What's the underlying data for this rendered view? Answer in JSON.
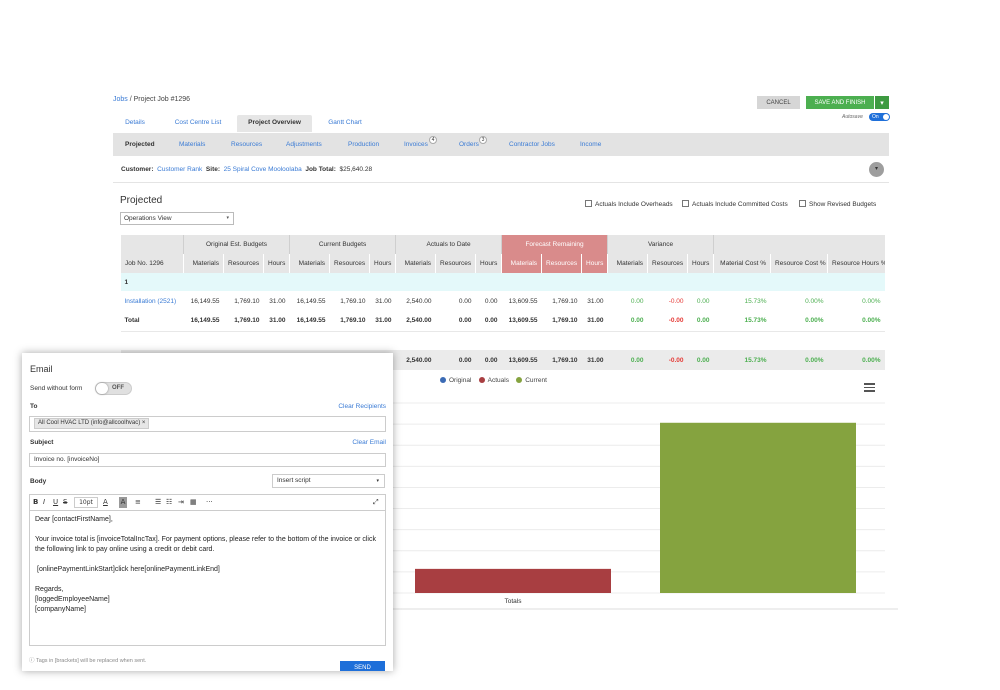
{
  "breadcrumb": {
    "root": "Jobs",
    "sep": " / ",
    "current": "Project Job #1296"
  },
  "actions": {
    "cancel": "CANCEL",
    "save": "SAVE AND FINISH",
    "save_dropdown": "▾"
  },
  "autosave": {
    "label": "Autosave",
    "state": "On",
    "color": "#1e6fd9"
  },
  "tabs": [
    {
      "label": "Details"
    },
    {
      "label": "Cost Centre List"
    },
    {
      "label": "Project Overview"
    },
    {
      "label": "Gantt Chart"
    }
  ],
  "subnav": [
    {
      "label": "Projected"
    },
    {
      "label": "Materials"
    },
    {
      "label": "Resources"
    },
    {
      "label": "Adjustments"
    },
    {
      "label": "Production"
    },
    {
      "label": "Invoices",
      "badge": "4"
    },
    {
      "label": "Orders",
      "badge": "3"
    },
    {
      "label": "Contractor Jobs"
    },
    {
      "label": "Income"
    }
  ],
  "customer": {
    "customer_label": "Customer:",
    "customer": "Customer Rank",
    "site_label": "Site:",
    "site": "25 Spiral Cove Mooloolaba",
    "total_label": "Job Total:",
    "total": "$25,640.28",
    "expand": "▾"
  },
  "projected": {
    "title": "Projected",
    "view": "Operations View",
    "view_arrow": "▾",
    "checks": [
      "Actuals Include Overheads",
      "Actuals Include Committed Costs",
      "Show Revised Budgets"
    ]
  },
  "table": {
    "groups": [
      "Original Est. Budgets",
      "Current Budgets",
      "Actuals to Date",
      "Forecast Remaining",
      "Variance"
    ],
    "job_col": "Job No. 1296",
    "sub_cols": [
      "Materials",
      "Resources",
      "Hours"
    ],
    "pct_cols": [
      "Material Cost %",
      "Resource Cost %",
      "Resource Hours %"
    ],
    "section": "1",
    "row": {
      "name": "Installation (2521)",
      "values": [
        "16,149.55",
        "1,769.10",
        "31.00",
        "16,149.55",
        "1,769.10",
        "31.00",
        "2,540.00",
        "0.00",
        "0.00",
        "13,609.55",
        "1,769.10",
        "31.00",
        "0.00",
        "-0.00",
        "0.00",
        "15.73%",
        "0.00%",
        "0.00%"
      ]
    },
    "total": {
      "name": "Total",
      "values": [
        "16,149.55",
        "1,769.10",
        "31.00",
        "16,149.55",
        "1,769.10",
        "31.00",
        "2,540.00",
        "0.00",
        "0.00",
        "13,609.55",
        "1,769.10",
        "31.00",
        "0.00",
        "-0.00",
        "0.00",
        "15.73%",
        "0.00%",
        "0.00%"
      ]
    },
    "grand": {
      "values": [
        "2,540.00",
        "0.00",
        "0.00",
        "13,609.55",
        "1,769.10",
        "31.00",
        "0.00",
        "-0.00",
        "0.00",
        "15.73%",
        "0.00%",
        "0.00%"
      ]
    },
    "forecast_color": "#d98b8b",
    "section_color": "#e4f9fa"
  },
  "chart_data": {
    "type": "bar",
    "categories": [
      "Totals"
    ],
    "series": [
      {
        "name": "Original",
        "color": "#3b6bb5",
        "values": [
          0
        ]
      },
      {
        "name": "Actuals",
        "color": "#a83e41",
        "values": [
          2540.0
        ]
      },
      {
        "name": "Current",
        "color": "#85a33f",
        "values": [
          17918.65
        ]
      }
    ],
    "ylim": [
      0,
      20000
    ],
    "grid": true,
    "legend": "top-center"
  },
  "email": {
    "title": "Email",
    "send_without_form": "Send without form",
    "toggle": "OFF",
    "to_label": "To",
    "clear_recipients": "Clear Recipients",
    "recipient": "All Cool HVAC LTD (info@allcoolhvac)",
    "recipient_remove": "×",
    "subject_label": "Subject",
    "clear_email": "Clear Email",
    "subject": "Invoice no. [invoiceNo]",
    "body_label": "Body",
    "insert_script": "Insert script",
    "insert_arrow": "▾",
    "toolbar": {
      "bold": "B",
      "italic": "I",
      "underline": "U",
      "strike": "S",
      "font_size": "10pt",
      "text_color": "A",
      "highlight": "A",
      "align": "≡",
      "bullets": "☰",
      "numbers": "☷",
      "indent": "⇥",
      "table": "▦",
      "more": "···",
      "fullscreen": "⤢"
    },
    "body_lines": [
      "Dear [contactFirstName],",
      "Your invoice total is [invoiceTotalIncTax]. For payment options, please refer to the bottom of the invoice or click the following link to pay online using a credit or debit card.",
      "[onlinePaymentLinkStart]click here[onlinePaymentLinkEnd]",
      "Regards,",
      "[loggedEmployeeName]",
      "[companyName]"
    ],
    "hint": "Tags in [brackets] will be replaced when sent.",
    "send": "SEND"
  }
}
